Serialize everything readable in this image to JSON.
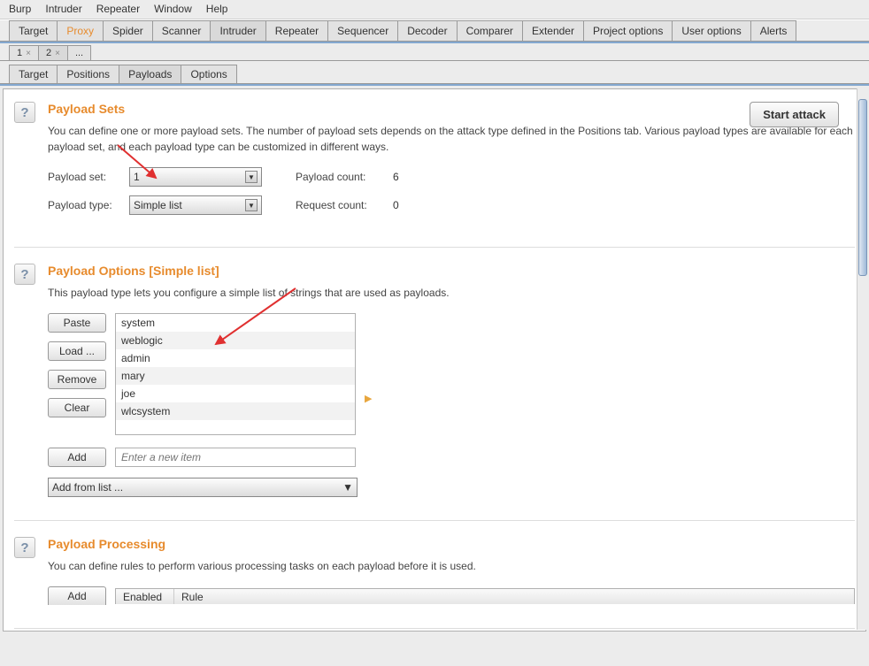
{
  "menubar": [
    "Burp",
    "Intruder",
    "Repeater",
    "Window",
    "Help"
  ],
  "main_tabs": [
    "Target",
    "Proxy",
    "Spider",
    "Scanner",
    "Intruder",
    "Repeater",
    "Sequencer",
    "Decoder",
    "Comparer",
    "Extender",
    "Project options",
    "User options",
    "Alerts"
  ],
  "main_tab_orange": "Proxy",
  "main_tab_selected": "Intruder",
  "session_tabs": [
    {
      "label": "1"
    },
    {
      "label": "2",
      "selected": true
    },
    {
      "label": "..."
    }
  ],
  "sub_tabs": [
    "Target",
    "Positions",
    "Payloads",
    "Options"
  ],
  "sub_tab_selected": "Payloads",
  "start_attack": "Start attack",
  "payload_sets": {
    "title": "Payload Sets",
    "desc": "You can define one or more payload sets. The number of payload sets depends on the attack type defined in the Positions tab. Various payload types are available for each payload set, and each payload type can be customized in different ways.",
    "set_label": "Payload set:",
    "set_value": "1",
    "type_label": "Payload type:",
    "type_value": "Simple list",
    "count_label": "Payload count:",
    "count_value": "6",
    "req_label": "Request count:",
    "req_value": "0"
  },
  "payload_options": {
    "title": "Payload Options [Simple list]",
    "desc": "This payload type lets you configure a simple list of strings that are used as payloads.",
    "buttons": {
      "paste": "Paste",
      "load": "Load ...",
      "remove": "Remove",
      "clear": "Clear",
      "add": "Add"
    },
    "items": [
      "system",
      "weblogic",
      "admin",
      "mary",
      "joe",
      "wlcsystem"
    ],
    "placeholder": "Enter a new item",
    "add_from_list": "Add from list ..."
  },
  "payload_processing": {
    "title": "Payload Processing",
    "desc": "You can define rules to perform various processing tasks on each payload before it is used.",
    "add": "Add",
    "col_enabled": "Enabled",
    "col_rule": "Rule"
  }
}
